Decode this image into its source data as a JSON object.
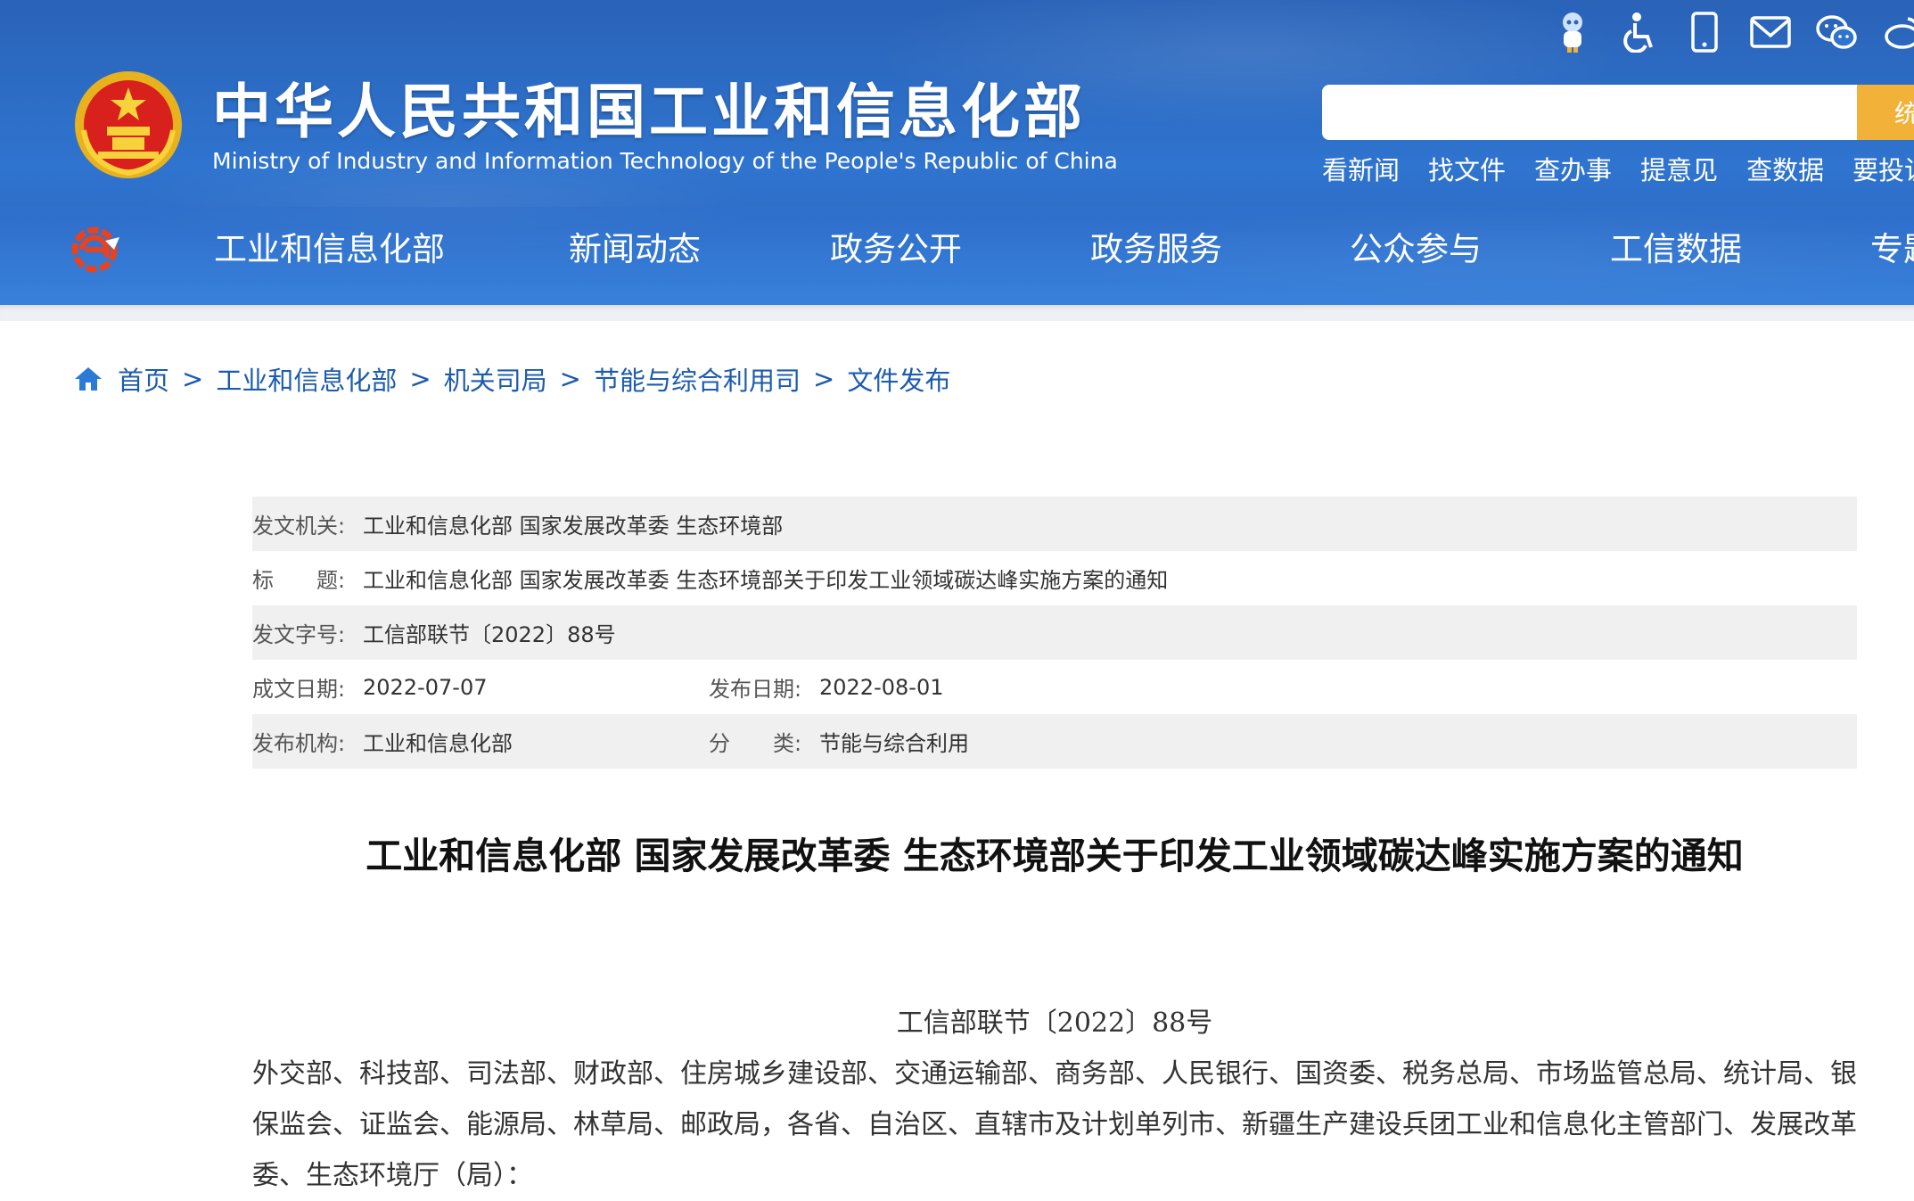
{
  "header": {
    "title": "中华人民共和国工业和信息化部",
    "subtitle": "Ministry of Industry and Information Technology of the People's Republic of China",
    "top_icons": [
      "robot-icon",
      "accessibility-icon",
      "mobile-icon",
      "mail-icon",
      "wechat-icon",
      "weibo-icon"
    ],
    "search": {
      "placeholder": "",
      "button_label": "统"
    },
    "quick_links": [
      "看新闻",
      "找文件",
      "查办事",
      "提意见",
      "查数据",
      "要投诉"
    ],
    "nav": [
      "工业和信息化部",
      "新闻动态",
      "政务公开",
      "政务服务",
      "公众参与",
      "工信数据",
      "专题"
    ]
  },
  "breadcrumb": [
    "首页",
    "工业和信息化部",
    "机关司局",
    "节能与综合利用司",
    "文件发布"
  ],
  "meta": {
    "issuer_label": "发文机关:",
    "issuer": "工业和信息化部 国家发展改革委 生态环境部",
    "title_label": "标　　题:",
    "title": "工业和信息化部 国家发展改革委 生态环境部关于印发工业领域碳达峰实施方案的通知",
    "doc_no_label": "发文字号:",
    "doc_no": "工信部联节〔2022〕88号",
    "written_date_label": "成文日期:",
    "written_date": "2022-07-07",
    "publish_date_label": "发布日期:",
    "publish_date": "2022-08-01",
    "publisher_label": "发布机构:",
    "publisher": "工业和信息化部",
    "category_label": "分　　类:",
    "category": "节能与综合利用"
  },
  "document": {
    "title": "工业和信息化部 国家发展改革委 生态环境部关于印发工业领域碳达峰实施方案的通知",
    "number": "工信部联节〔2022〕88号",
    "recipients": "外交部、科技部、司法部、财政部、住房城乡建设部、交通运输部、商务部、人民银行、国资委、税务总局、市场监管总局、统计局、银保监会、证监会、能源局、林草局、邮政局，各省、自治区、直辖市及计划单列市、新疆生产建设兵团工业和信息化主管部门、发展改革委、生态环境厅（局）："
  },
  "colors": {
    "header_blue": "#2f74cf",
    "search_button": "#f2b23a",
    "link_blue": "#1c5bae",
    "meta_shade": "#f0f0f0"
  }
}
